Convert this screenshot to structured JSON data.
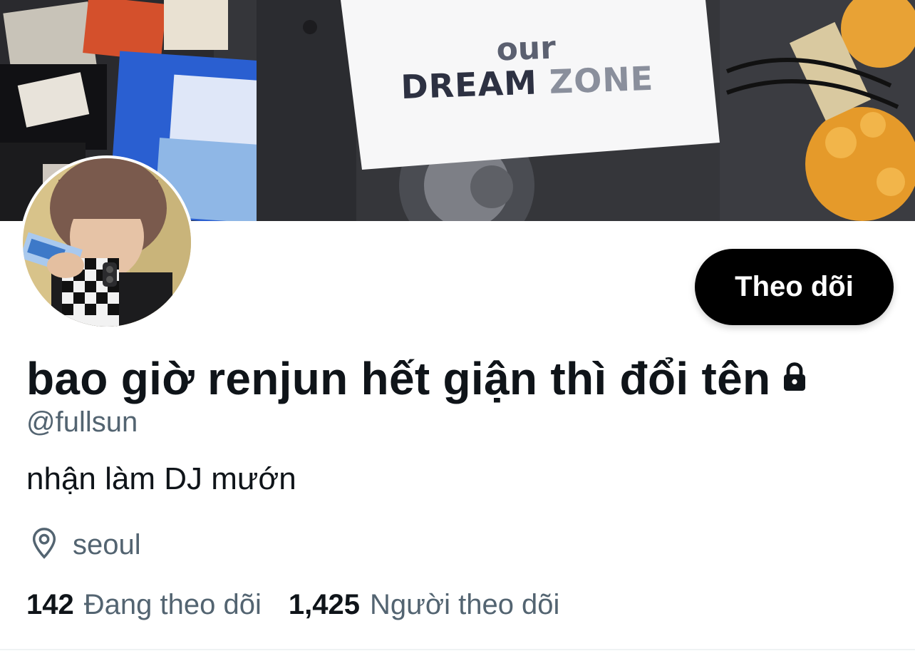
{
  "banner": {
    "sign_line_1": "our",
    "sign_line_2a": "DREAM",
    "sign_line_2b": "ZONE"
  },
  "profile": {
    "display_name": "bao giờ renjun hết giận thì đổi tên",
    "handle": "@fullsun",
    "bio": "nhận làm DJ mướn",
    "location": "seoul",
    "protected_icon": "lock-icon",
    "location_icon": "location-pin-icon"
  },
  "actions": {
    "follow_label": "Theo dõi"
  },
  "stats": {
    "following_count": "142",
    "following_label": "Đang theo dõi",
    "followers_count": "1,425",
    "followers_label": "Người theo dõi"
  },
  "colors": {
    "primary_text": "#0f1419",
    "secondary_text": "#536471",
    "button_bg": "#000000",
    "button_text": "#ffffff"
  }
}
